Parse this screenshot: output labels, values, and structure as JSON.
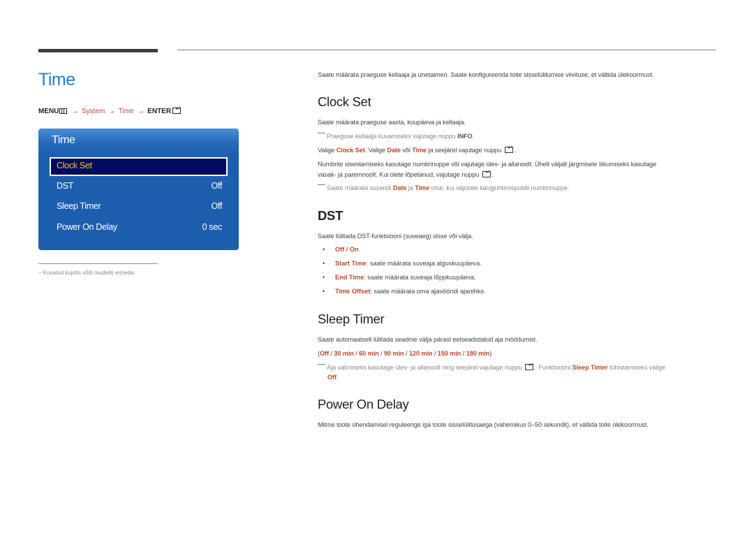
{
  "page": {
    "title": "Time"
  },
  "breadcrumb": {
    "menu": "MENU",
    "menu_icon": "menu-icon",
    "arrow": "→",
    "system": "System",
    "time": "Time",
    "enter": "ENTER",
    "enter_icon": "enter-icon"
  },
  "osd": {
    "title": "Time",
    "items": [
      {
        "label": "Clock Set",
        "value": "",
        "selected": true
      },
      {
        "label": "DST",
        "value": "Off"
      },
      {
        "label": "Sleep Timer",
        "value": "Off"
      },
      {
        "label": "Power On Delay",
        "value": "0 sec"
      }
    ]
  },
  "footnote": "Kuvatud kujutis võib mudeliti erineda.",
  "intro": "Saate määrata praeguse kellaaja ja unetaimeri. Saate konfigureerida toite sisselülitumise viivituse, et vältida ülekoormust.",
  "clock_set": {
    "heading": "Clock Set",
    "desc": "Saate määrata praeguse aasta, kuupäeva ja kellaaja.",
    "note1_pre": "Praeguse kellaaja kuvamiseks vajutage nuppu ",
    "note1_key": "INFO",
    "note1_post": ".",
    "step_1": "Valige ",
    "step_clock": "Clock Set",
    "step_2": ". Valige ",
    "step_date": "Date",
    "step_3": " või ",
    "step_time": "Time",
    "step_4": " ja seejärel vajutage nuppu ",
    "step_5": ".",
    "numbers_line1": "Numbrite sisestamiseks kasutage numbrinuppe või vajutage üles- ja allanoolt. Ühelt väljalt järgmisele liikumiseks kasutage",
    "numbers_line2": "vasak- ja paremnoolt. Kui olete lõpetanud, vajutage nuppu ",
    "numbers_end": ".",
    "note2_pre": "Saate määrata suvandi ",
    "note2_date": "Date",
    "note2_mid": " ja ",
    "note2_time": "Time",
    "note2_post": " otse, kui vajutate kaugjuhtimispuldil numbrinuppe."
  },
  "dst": {
    "heading": "DST",
    "desc": "Saate lülitada DST-funktsiooni (suveaeg) sisse või välja.",
    "bullets": [
      {
        "term": "Off / On",
        "text": ""
      },
      {
        "term": "Start Time",
        "text": ": saate määrata suveaja alguskuupäeva."
      },
      {
        "term": "End Time",
        "text": ": saate määrata suveaja lõppkuupäeva."
      },
      {
        "term": "Time Offset",
        "text": ": saate määrata oma ajavööndi ajanihke."
      }
    ]
  },
  "sleep_timer": {
    "heading": "Sleep Timer",
    "desc": "Saate automaatselt lülitada seadme välja pärast eelseadistatud aja möödumist.",
    "options": [
      "Off",
      "30 min",
      "60 min",
      "90 min",
      "120 min",
      "150 min",
      "180 min"
    ],
    "note_pre": "Aja valimiseks kasutage üles- ja allanoolt ning seejärel vajutage nuppu ",
    "note_mid": ". Funktsiooni ",
    "note_term": "Sleep Timer",
    "note_post": " tühistamiseks valige",
    "note_off": "Off",
    "note_end": "."
  },
  "power_on_delay": {
    "heading": "Power On Delay",
    "desc": "Mitme toote ühendamisel reguleerige iga toote sisselülitusaega (vahemikus 0–50 sekundit), et vältida toite ülekoormust."
  },
  "colors": {
    "title_blue": "#1f7fc8",
    "highlight": "#c0462a",
    "osd_bg": "#1d5fae",
    "osd_selected_bg": "#000a5e",
    "osd_selected_text": "#f5c020"
  }
}
